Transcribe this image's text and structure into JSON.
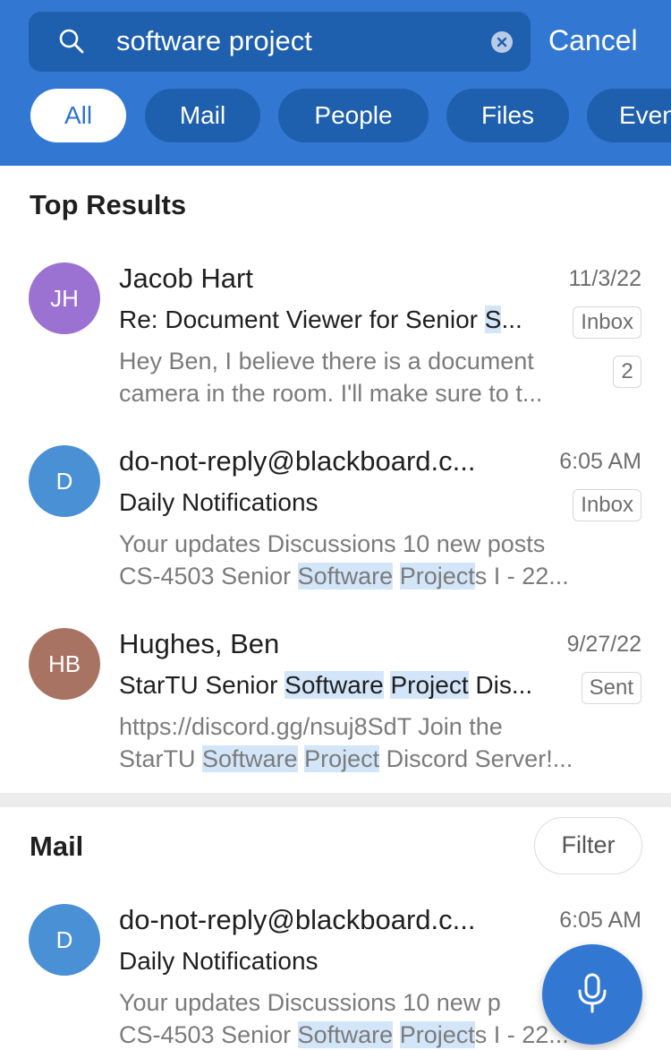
{
  "search": {
    "query": "software project",
    "cancel_label": "Cancel"
  },
  "filters": [
    {
      "label": "All",
      "active": true
    },
    {
      "label": "Mail",
      "active": false
    },
    {
      "label": "People",
      "active": false
    },
    {
      "label": "Files",
      "active": false
    },
    {
      "label": "Even",
      "active": false
    }
  ],
  "top_results": {
    "title": "Top Results",
    "items": [
      {
        "initials": "JH",
        "avatar_color": "#9b72d1",
        "sender": "Jacob Hart",
        "date": "11/3/22",
        "subject_plain": "Re: Document Viewer for Senior ",
        "subject_hl": "S",
        "subject_end": "...",
        "folder": "Inbox",
        "preview_line1": "Hey Ben, I believe there is a document",
        "preview_line2": "camera in the room. I'll make sure to t...",
        "count": "2"
      },
      {
        "initials": "D",
        "avatar_color": "#4a90d4",
        "sender": "do-not-reply@blackboard.c...",
        "date": "6:05 AM",
        "subject": "Daily Notifications",
        "folder": "Inbox",
        "preview_line1": "Your updates Discussions 10 new posts",
        "preview_line2_a": "CS-4503 Senior ",
        "preview_line2_hl1": "Software",
        "preview_line2_b": " ",
        "preview_line2_hl2": "Project",
        "preview_line2_c": "s I - 22..."
      },
      {
        "initials": "HB",
        "avatar_color": "#a87362",
        "sender": "Hughes, Ben",
        "date": "9/27/22",
        "subject_a": "StarTU Senior ",
        "subject_hl1": "Software",
        "subject_b": " ",
        "subject_hl2": "Project",
        "subject_c": " Dis...",
        "folder": "Sent",
        "preview_line1": "https://discord.gg/nsuj8SdT Join the",
        "preview_line2_a": "StarTU ",
        "preview_line2_hl1": "Software",
        "preview_line2_b": " ",
        "preview_line2_hl2": "Project",
        "preview_line2_c": " Discord Server!..."
      }
    ]
  },
  "mail": {
    "title": "Mail",
    "filter_label": "Filter",
    "items": [
      {
        "initials": "D",
        "avatar_color": "#4a90d4",
        "sender": "do-not-reply@blackboard.c...",
        "date": "6:05 AM",
        "subject": "Daily Notifications",
        "preview_line1": "Your updates Discussions 10 new p",
        "preview_line2_a": "CS-4503 Senior ",
        "preview_line2_hl1": "Software",
        "preview_line2_b": " ",
        "preview_line2_hl2": "Project",
        "preview_line2_c": "s I - 22..."
      }
    ]
  },
  "icons": {
    "search": "search-icon",
    "clear": "clear-icon",
    "microphone": "microphone-icon"
  },
  "colors": {
    "header_bg": "#3278d3",
    "search_bg": "#1e5fae",
    "highlight": "#d3e5f8"
  }
}
